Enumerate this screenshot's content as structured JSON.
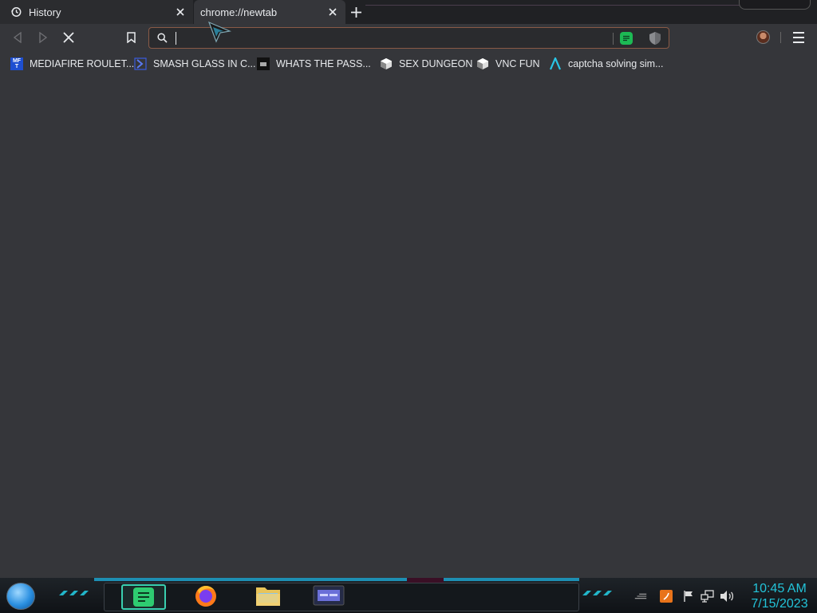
{
  "tabs": [
    {
      "title": "History",
      "icon": "history-icon",
      "active": false
    },
    {
      "title": "chrome://newtab",
      "icon": null,
      "active": true
    }
  ],
  "toolbar": {
    "omnibox_value": "",
    "omnibox_placeholder": ""
  },
  "bookmarks": [
    {
      "label": "MEDIAFIRE ROULET...",
      "icon": "mediafire-icon",
      "icon_text": "MF\nT",
      "icon_color": "#1e4fd1"
    },
    {
      "label": "SMASH GLASS IN C...",
      "icon": "chevron-logo-icon",
      "icon_color": "#3b5bdb"
    },
    {
      "label": "WHATS THE PASS...",
      "icon": "dark-site-icon",
      "icon_color": "#111111"
    },
    {
      "label": "SEX DUNGEON",
      "icon": "cube-icon",
      "icon_color": "#cccccc"
    },
    {
      "label": "VNC FUN",
      "icon": "cube-icon",
      "icon_color": "#cccccc"
    },
    {
      "label": "captcha solving sim...",
      "icon": "lambda-icon",
      "icon_color": "#29c5e6"
    }
  ],
  "taskbar": {
    "apps": [
      "chat-app-icon",
      "firefox-icon",
      "file-explorer-icon",
      "window-app-icon"
    ]
  },
  "clock": {
    "time": "10:45 AM",
    "date": "7/15/2023"
  },
  "colors": {
    "background": "#35363a",
    "omnibox_border": "#8a5a46",
    "clock": "#23c3d8",
    "taskbar_accent": "#1d8fb3"
  }
}
